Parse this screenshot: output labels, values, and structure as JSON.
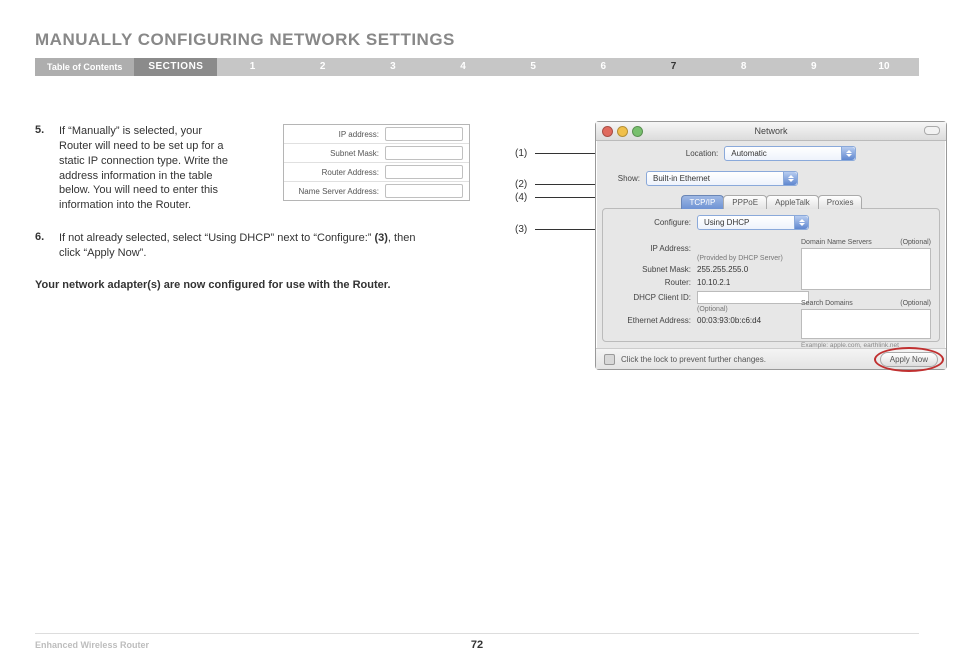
{
  "header": {
    "title": "MANUALLY CONFIGURING NETWORK SETTINGS"
  },
  "nav": {
    "toc": "Table of Contents",
    "sections_label": "SECTIONS",
    "items": [
      "1",
      "2",
      "3",
      "4",
      "5",
      "6",
      "7",
      "8",
      "9",
      "10"
    ],
    "active_index": 6
  },
  "steps": {
    "s5_num": "5.",
    "s5_text": "If “Manually” is selected, your Router will need to be set up for a static IP connection type. Write the address information in the table below. You will need to enter this information into the Router.",
    "s6_num": "6.",
    "s6_text_a": "If not already selected, select “Using DHCP” next to “Configure:” ",
    "s6_text_bold": "(3)",
    "s6_text_b": ", then click “Apply Now”.",
    "confirm": "Your network adapter(s) are now configured for use with the Router."
  },
  "ip_box": {
    "rows": [
      "IP address:",
      "Subnet Mask:",
      "Router Address:",
      "Name Server Address:"
    ]
  },
  "callouts": {
    "c1": "(1)",
    "c2": "(2)",
    "c3": "(3)",
    "c4": "(4)"
  },
  "win": {
    "title": "Network",
    "location_label": "Location:",
    "location_value": "Automatic",
    "show_label": "Show:",
    "show_value": "Built-in Ethernet",
    "tabs": {
      "tcpip": "TCP/IP",
      "pppoe": "PPPoE",
      "appletalk": "AppleTalk",
      "proxies": "Proxies"
    },
    "configure_label": "Configure:",
    "configure_value": "Using DHCP",
    "ip_label": "IP Address:",
    "ip_hint": "(Provided by DHCP Server)",
    "subnet_label": "Subnet Mask:",
    "subnet_value": "255.255.255.0",
    "router_label": "Router:",
    "router_value": "10.10.2.1",
    "dhcp_label": "DHCP Client ID:",
    "dhcp_hint": "(Optional)",
    "eth_label": "Ethernet Address:",
    "eth_value": "00:03:93:0b:c6:d4",
    "dns_head": "Domain Name Servers",
    "optional": "(Optional)",
    "search_head": "Search Domains",
    "example": "Example: apple.com, earthlink.net",
    "lock_text": "Click the lock to prevent further changes.",
    "apply": "Apply Now"
  },
  "footer": {
    "product": "Enhanced Wireless Router",
    "page": "72"
  }
}
